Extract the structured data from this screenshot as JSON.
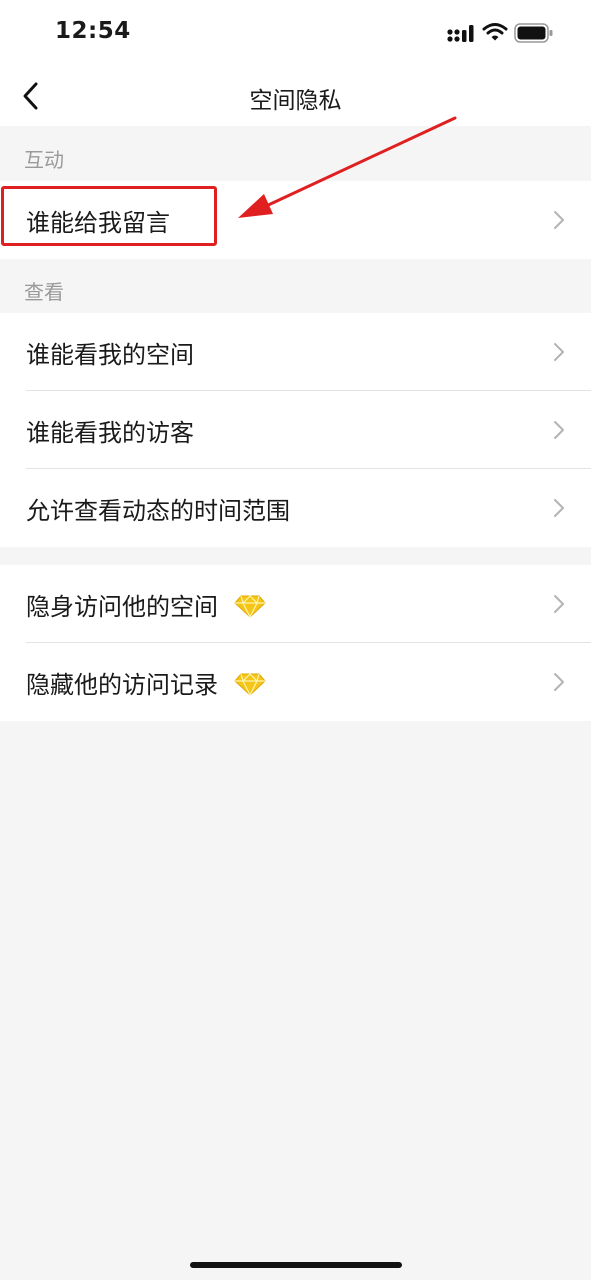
{
  "status_bar": {
    "time": "12:54"
  },
  "nav": {
    "title": "空间隐私"
  },
  "sections": {
    "interaction": {
      "header": "互动",
      "items": [
        "谁能给我留言"
      ]
    },
    "view": {
      "header": "查看",
      "items": [
        "谁能看我的空间",
        "谁能看我的访客",
        "允许查看动态的时间范围"
      ]
    },
    "vip": {
      "items": [
        "隐身访问他的空间",
        "隐藏他的访问记录"
      ]
    }
  },
  "colors": {
    "background": "#f5f5f5",
    "annotation": "#e02020",
    "vip_diamond": "#f5c518"
  }
}
